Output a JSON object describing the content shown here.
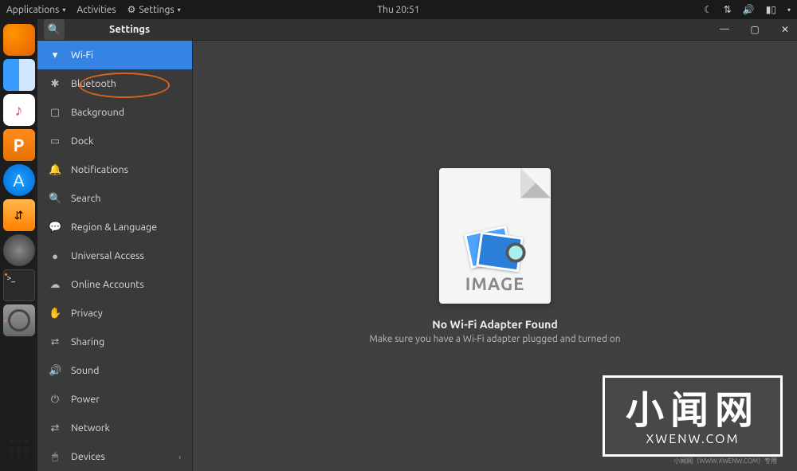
{
  "topbar": {
    "applications": "Applications",
    "activities": "Activities",
    "current_app": "Settings",
    "clock": "Thu 20:51"
  },
  "window": {
    "title": "Settings",
    "controls": {
      "min": "—",
      "max": "▢",
      "close": "✕"
    }
  },
  "sidebar": {
    "items": [
      {
        "icon": "wifi",
        "label": "Wi-Fi",
        "active": true
      },
      {
        "icon": "bluetooth",
        "label": "Bluetooth",
        "circled": true
      },
      {
        "icon": "background",
        "label": "Background"
      },
      {
        "icon": "dock",
        "label": "Dock"
      },
      {
        "icon": "notifications",
        "label": "Notifications"
      },
      {
        "icon": "search",
        "label": "Search"
      },
      {
        "icon": "region",
        "label": "Region & Language"
      },
      {
        "icon": "universal",
        "label": "Universal Access"
      },
      {
        "icon": "online",
        "label": "Online Accounts"
      },
      {
        "icon": "privacy",
        "label": "Privacy"
      },
      {
        "icon": "sharing",
        "label": "Sharing"
      },
      {
        "icon": "sound",
        "label": "Sound"
      },
      {
        "icon": "power",
        "label": "Power"
      },
      {
        "icon": "network",
        "label": "Network"
      },
      {
        "icon": "devices",
        "label": "Devices",
        "sub": true
      }
    ]
  },
  "main": {
    "placeholder_text": "IMAGE",
    "title": "No Wi-Fi Adapter Found",
    "subtitle": "Make sure you have a Wi-Fi adapter plugged and turned on"
  },
  "watermark": {
    "cn": "小闻网",
    "en": "XWENW.COM",
    "tiny": "小闻网（WWW.XWENW.COM）专用"
  },
  "icons": {
    "wifi": "▾",
    "bluetooth": "✱",
    "background": "▢",
    "dock": "▭",
    "notifications": "🔔",
    "search": "🔍",
    "region": "💬",
    "universal": "●",
    "online": "☁",
    "privacy": "✋",
    "sharing": "⮂",
    "sound": "🔊",
    "power": "⏻",
    "network": "⇄",
    "devices": "🖱"
  }
}
